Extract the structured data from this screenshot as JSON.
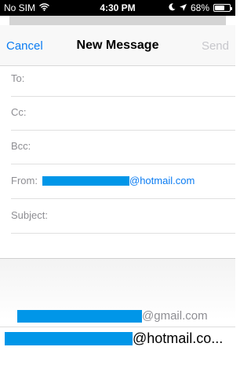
{
  "status": {
    "carrier": "No SIM",
    "time": "4:30 PM",
    "battery": "68%",
    "battery_level": 0.68
  },
  "nav": {
    "cancel": "Cancel",
    "title": "New Message",
    "send": "Send"
  },
  "fields": {
    "to_label": "To:",
    "cc_label": "Cc:",
    "bcc_label": "Bcc:",
    "from_label": "From:",
    "from_domain": "@hotmail.com",
    "subject_label": "Subject:"
  },
  "suggestions": [
    {
      "domain": "@gmail.com"
    },
    {
      "domain": "@hotmail.co..."
    }
  ],
  "colors": {
    "accent": "#0a7cf2",
    "redaction": "#0096e8"
  },
  "icons": [
    "wifi-icon",
    "moon-icon",
    "location-arrow-icon",
    "battery-icon"
  ]
}
